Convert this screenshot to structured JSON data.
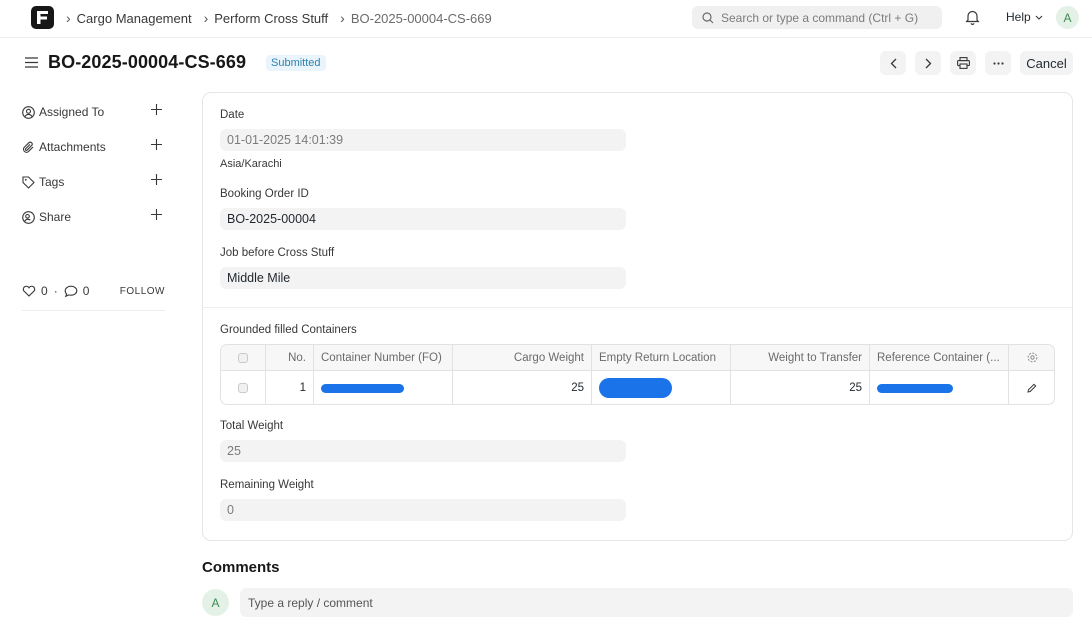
{
  "navbar": {
    "breadcrumbs": [
      "Cargo Management",
      "Perform Cross Stuff",
      "BO-2025-00004-CS-669"
    ],
    "search_placeholder": "Search or type a command (Ctrl + G)",
    "help_label": "Help",
    "user_initial": "A"
  },
  "page": {
    "title": "BO-2025-00004-CS-669",
    "status": "Submitted",
    "cancel_label": "Cancel"
  },
  "sidebar": {
    "items": [
      {
        "label": "Assigned To",
        "icon": "user-plus-icon"
      },
      {
        "label": "Attachments",
        "icon": "paperclip-icon"
      },
      {
        "label": "Tags",
        "icon": "tag-icon"
      },
      {
        "label": "Share",
        "icon": "share-user-icon"
      }
    ],
    "likes": "0",
    "comments": "0",
    "follow_label": "FOLLOW"
  },
  "form": {
    "date_label": "Date",
    "date_value": "01-01-2025 14:01:39",
    "timezone": "Asia/Karachi",
    "booking_label": "Booking Order ID",
    "booking_value": "BO-2025-00004",
    "job_label": "Job before Cross Stuff",
    "job_value": "Middle Mile",
    "table_label": "Grounded filled Containers",
    "table": {
      "columns": [
        "No.",
        "Container Number (FO)",
        "Cargo Weight",
        "Empty Return Location",
        "Weight to Transfer",
        "Reference Container (..."
      ],
      "rows": [
        {
          "no": "1",
          "cargo_weight": "25",
          "weight_to_transfer": "25"
        }
      ]
    },
    "total_label": "Total Weight",
    "total_value": "25",
    "remaining_label": "Remaining Weight",
    "remaining_value": "0"
  },
  "comments": {
    "heading": "Comments",
    "avatar_initial": "A",
    "placeholder": "Type a reply / comment"
  },
  "colors": {
    "badge_bg": "#eaf5fb",
    "badge_text": "#2f7fb0",
    "redaction": "#1a73e8",
    "avatar_bg": "#e3f1e6"
  }
}
